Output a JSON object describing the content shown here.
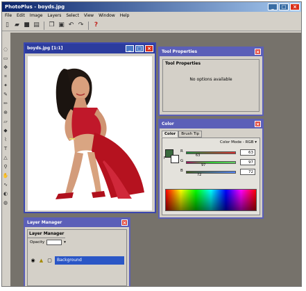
{
  "app": {
    "title": "PhotoPlus - boyds.jpg",
    "window_buttons": [
      "_",
      "□",
      "×"
    ]
  },
  "menu": [
    "File",
    "Edit",
    "Image",
    "Layers",
    "Select",
    "View",
    "Window",
    "Help"
  ],
  "toolbar_icons": [
    "new-icon",
    "open-icon",
    "save-icon",
    "print-icon",
    "copy-icon",
    "paste-icon",
    "undo-icon",
    "redo-icon",
    "help-icon"
  ],
  "image_window": {
    "title": "boyds.jpg [1:1]"
  },
  "tool_properties": {
    "title": "Tool Properties",
    "header": "Tool Properties",
    "message": "No options available"
  },
  "color": {
    "title": "Color",
    "tabs": [
      "Color",
      "Brush Tip"
    ],
    "mode_label": "Color Mode - RGB",
    "fg_label": "F",
    "bg_label": "B",
    "channels": [
      {
        "label": "R",
        "value": "63",
        "mark": "63",
        "gradient": [
          "#00aa44",
          "#ff4444"
        ]
      },
      {
        "label": "G",
        "value": "97",
        "mark": "97",
        "gradient": [
          "#aa0055",
          "#44ff55"
        ]
      },
      {
        "label": "B",
        "value": "72",
        "mark": "72",
        "gradient": [
          "#446622",
          "#5566ff"
        ]
      }
    ],
    "fg_color": "#3a6a3e",
    "bg_color": "#ffffff"
  },
  "layer_manager": {
    "title": "Layer Manager",
    "header": "Layer Manager",
    "opacity_label": "Opacity",
    "opacity_value": "",
    "layer_name": "Background"
  }
}
